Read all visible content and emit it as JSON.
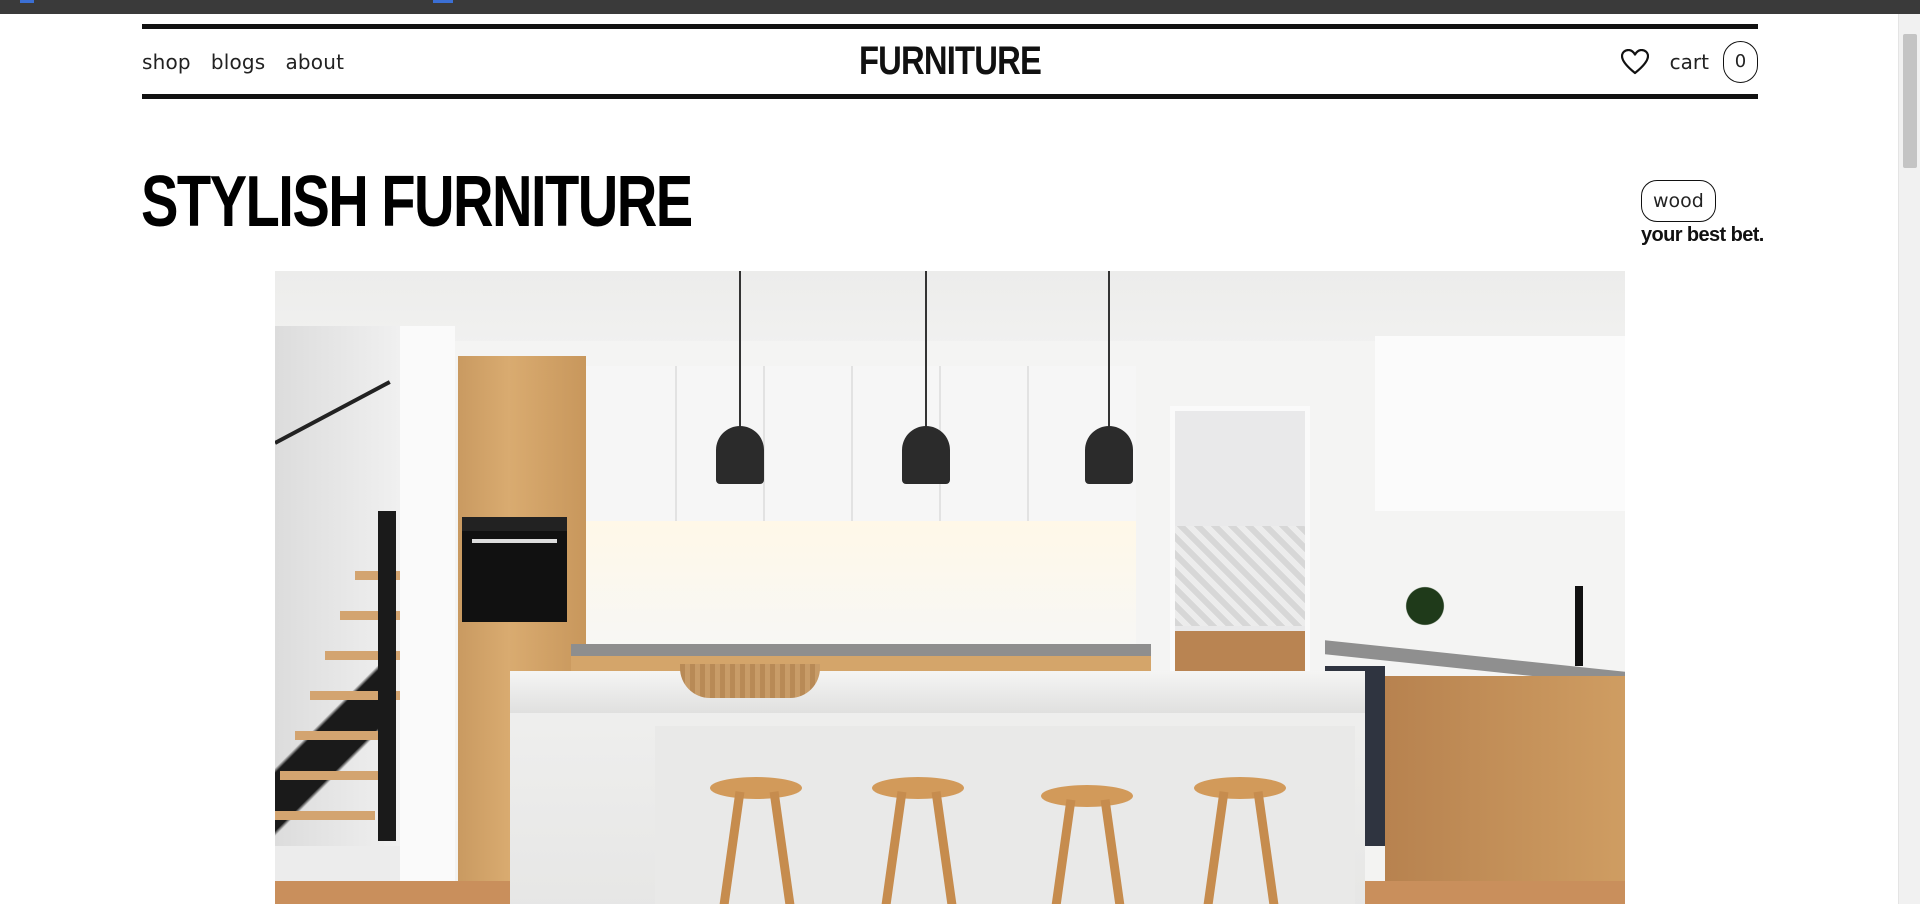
{
  "nav": {
    "links": [
      "shop",
      "blogs",
      "about"
    ]
  },
  "brand": {
    "logo": "FURNITURE"
  },
  "header": {
    "favorites_icon": "heart-icon",
    "cart_label": "cart",
    "cart_count": "0"
  },
  "hero": {
    "title": "STYLISH FURNITURE",
    "tag": "wood",
    "tagline": "your best bet."
  },
  "colors": {
    "text": "#111111",
    "background": "#ffffff",
    "rule": "#111111"
  }
}
